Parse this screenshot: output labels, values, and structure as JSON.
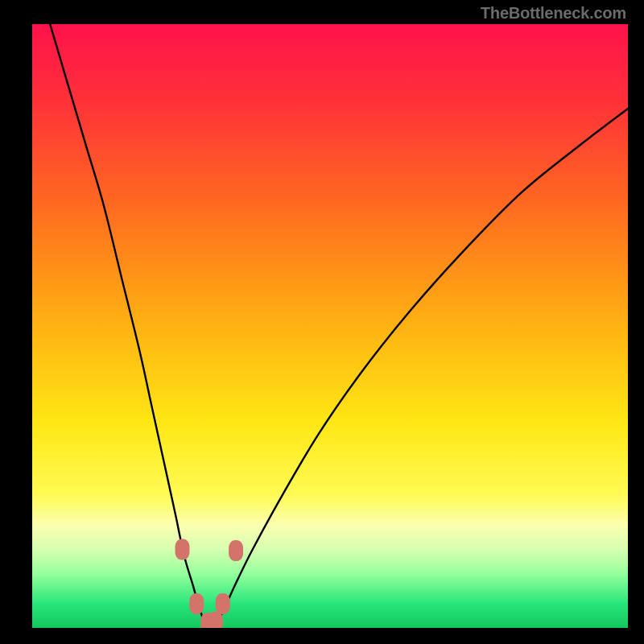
{
  "watermark": "TheBottleneck.com",
  "chart_data": {
    "type": "line",
    "title": "",
    "xlabel": "",
    "ylabel": "",
    "xlim": [
      0,
      100
    ],
    "ylim": [
      0,
      100
    ],
    "grid": false,
    "legend": false,
    "background_gradient_stops": [
      {
        "offset": 0.0,
        "color": "#ff124b"
      },
      {
        "offset": 0.12,
        "color": "#ff2f3a"
      },
      {
        "offset": 0.3,
        "color": "#ff6a20"
      },
      {
        "offset": 0.5,
        "color": "#ffb212"
      },
      {
        "offset": 0.66,
        "color": "#ffe714"
      },
      {
        "offset": 0.78,
        "color": "#fffb55"
      },
      {
        "offset": 0.83,
        "color": "#fbffb0"
      },
      {
        "offset": 0.87,
        "color": "#d6ffb0"
      },
      {
        "offset": 0.91,
        "color": "#96ff9c"
      },
      {
        "offset": 0.96,
        "color": "#28e67a"
      },
      {
        "offset": 1.0,
        "color": "#14c85e"
      }
    ],
    "series": [
      {
        "name": "bottleneck-curve",
        "color": "#000000",
        "x": [
          3,
          6,
          9,
          12,
          15,
          18,
          20,
          22,
          24,
          25.5,
          27,
          28,
          28.8,
          29.4,
          30.2,
          31.2,
          32.4,
          34,
          37,
          42,
          48,
          55,
          63,
          72,
          82,
          92,
          100
        ],
        "y": [
          100,
          90,
          80,
          70,
          58,
          46,
          37,
          28,
          19,
          12,
          7,
          3.5,
          1.2,
          0.2,
          0.2,
          1.2,
          3.5,
          7,
          13,
          22,
          32,
          42,
          52,
          62,
          72,
          80,
          86
        ]
      }
    ],
    "markers": [
      {
        "x": 25.2,
        "y": 13.0,
        "color": "#d3736a"
      },
      {
        "x": 27.6,
        "y": 4.0,
        "color": "#d3736a"
      },
      {
        "x": 29.5,
        "y": 0.8,
        "color": "#d3736a"
      },
      {
        "x": 30.8,
        "y": 1.0,
        "color": "#d3736a"
      },
      {
        "x": 32.0,
        "y": 4.0,
        "color": "#d3736a"
      },
      {
        "x": 34.2,
        "y": 12.8,
        "color": "#d3736a"
      }
    ]
  }
}
